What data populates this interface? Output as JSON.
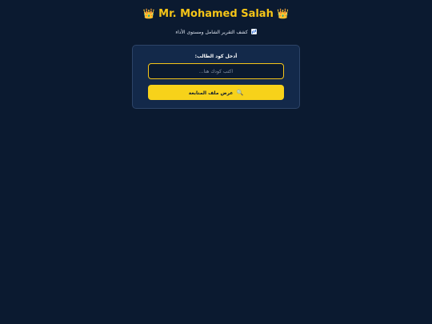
{
  "header": {
    "title": "Mr. Mohamed Salah",
    "crown_glyph": "👑",
    "subtitle": "كشف التقرير الشامل ومستوى الأداء",
    "subtitle_icon": "chart-icon",
    "title_color": "#f5c518"
  },
  "form": {
    "label": "أدخل كود الطالب:",
    "input_placeholder": "اكتب كودك هنا...",
    "input_value": "",
    "button_label": "عرض ملف المتابعة",
    "button_icon_glyph": "🔍",
    "accent_color": "#f7d21a"
  },
  "background_color": "#0b1a30"
}
